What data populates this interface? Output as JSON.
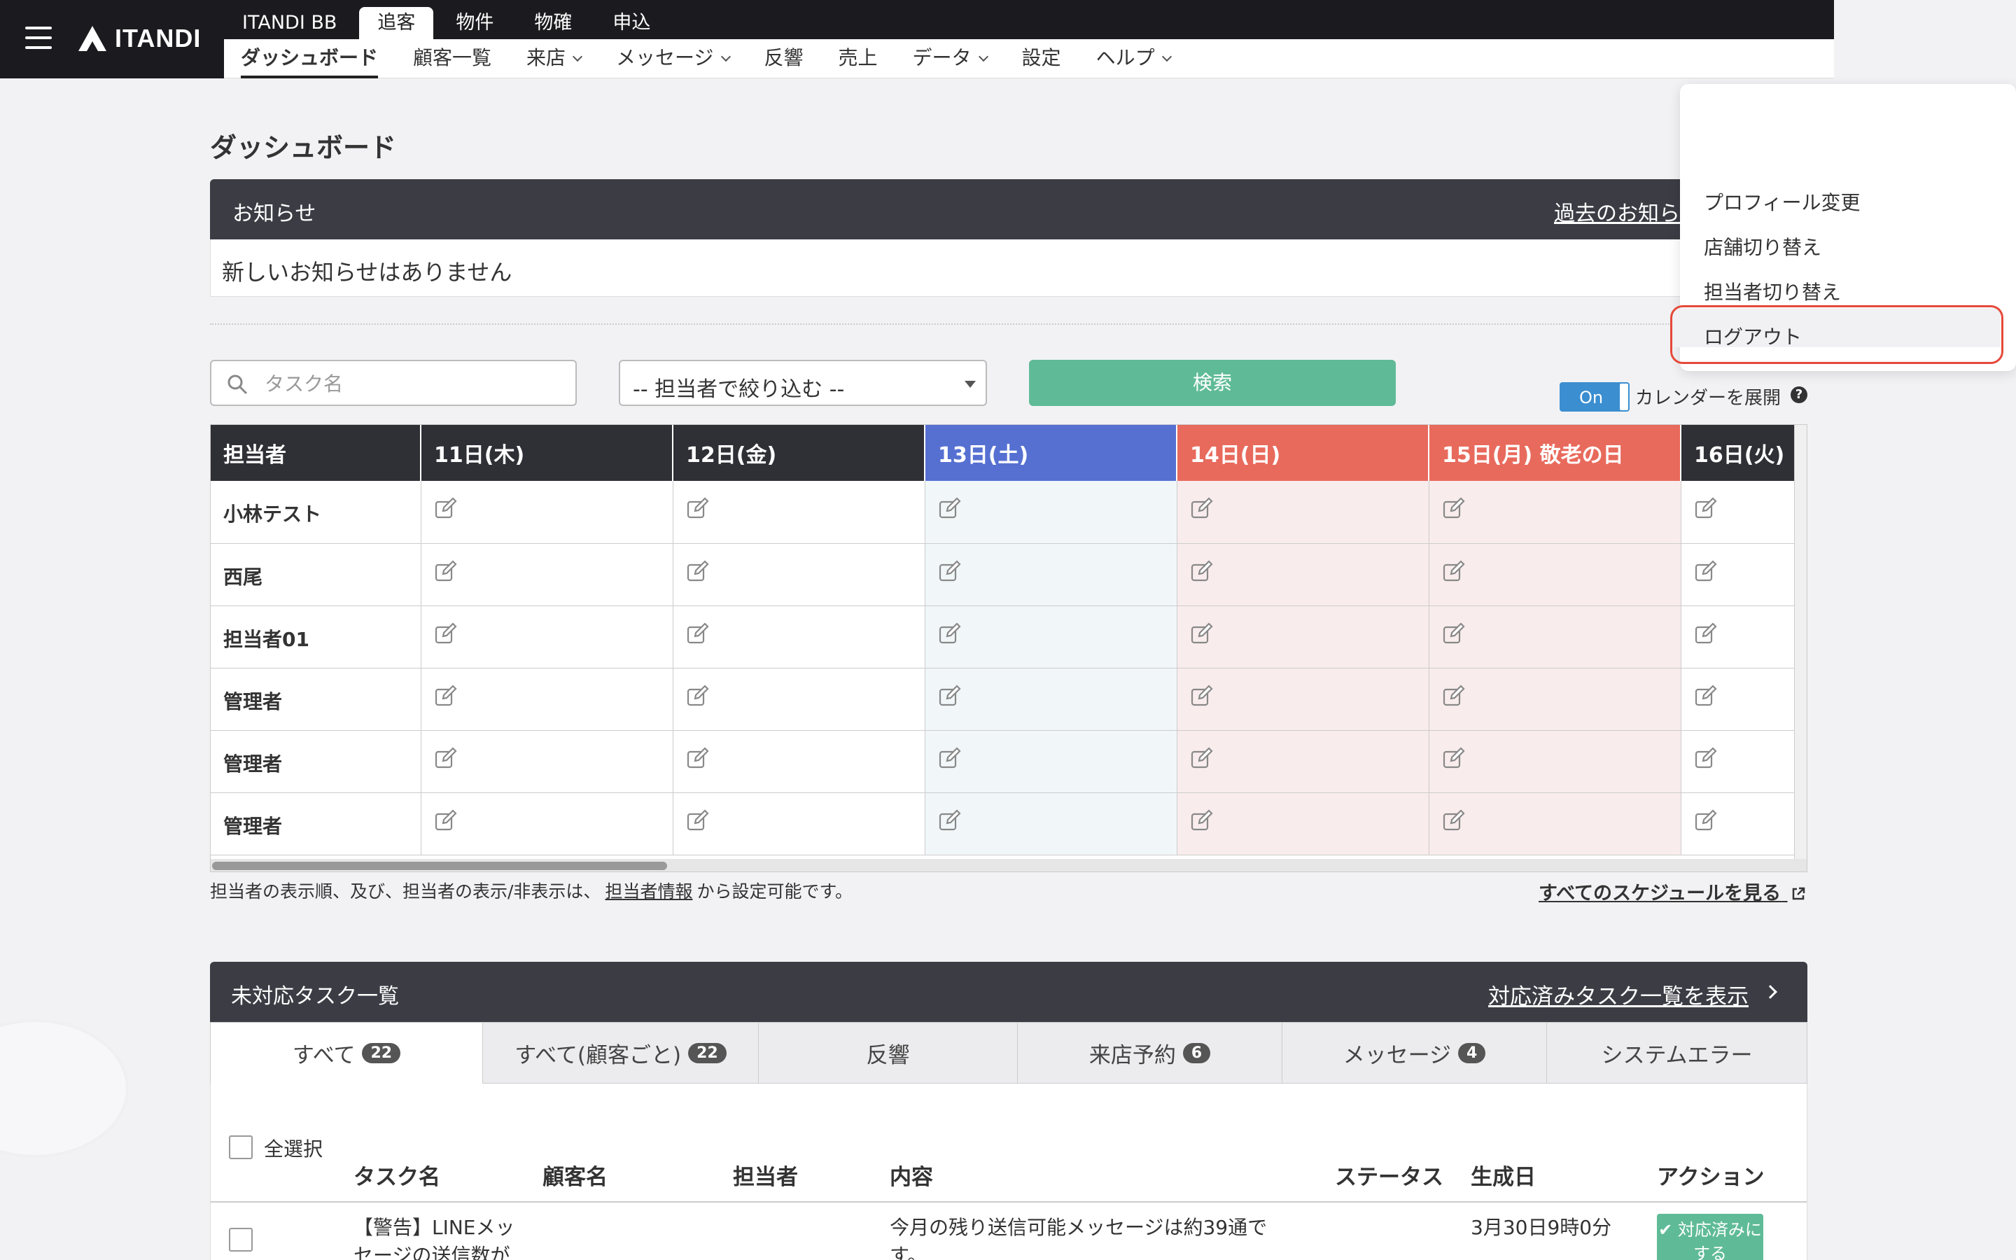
{
  "header": {
    "logo": "ITANDI",
    "top_tabs": [
      "ITANDI BB",
      "追客",
      "物件",
      "物確",
      "申込"
    ],
    "sub_nav": [
      "ダッシュボード",
      "顧客一覧",
      "来店",
      "メッセージ",
      "反響",
      "売上",
      "データ",
      "設定",
      "ヘルプ"
    ]
  },
  "page": {
    "title": "ダッシュボード"
  },
  "notice": {
    "title": "お知らせ",
    "past_link": "過去のお知ら",
    "empty": "新しいお知らせはありません"
  },
  "filters": {
    "task_placeholder": "タスク名",
    "assignee_select": "-- 担当者で絞り込む --",
    "search_button": "検索",
    "toggle_state": "On",
    "toggle_label": "カレンダーを展開"
  },
  "calendar": {
    "header_first": "担当者",
    "days": [
      {
        "label": "11日(木)",
        "type": "weekday"
      },
      {
        "label": "12日(金)",
        "type": "weekday"
      },
      {
        "label": "13日(土)",
        "type": "sat"
      },
      {
        "label": "14日(日)",
        "type": "sun"
      },
      {
        "label": "15日(月) 敬老の日",
        "type": "sun"
      },
      {
        "label": "16日(火)",
        "type": "weekday"
      }
    ],
    "assignees": [
      "小林テスト",
      "西尾",
      "担当者01",
      "管理者",
      "管理者",
      "管理者"
    ],
    "note_prefix": "担当者の表示順、及び、担当者の表示/非表示は、",
    "note_link": "担当者情報",
    "note_suffix": "から設定可能です。",
    "all_schedule_link": "すべてのスケジュールを見る",
    "colors": {
      "sat": "#5670d2",
      "sun": "#e86a5c",
      "dark": "#2f2f36"
    }
  },
  "tasks": {
    "title": "未対応タスク一覧",
    "done_link": "対応済みタスク一覧を表示",
    "tabs": [
      {
        "label": "すべて",
        "count": "22"
      },
      {
        "label": "すべて(顧客ごと)",
        "count": "22"
      },
      {
        "label": "反響",
        "count": ""
      },
      {
        "label": "来店予約",
        "count": "6"
      },
      {
        "label": "メッセージ",
        "count": "4"
      },
      {
        "label": "システムエラー",
        "count": ""
      }
    ],
    "select_all": "全選択",
    "columns": [
      "タスク名",
      "顧客名",
      "担当者",
      "内容",
      "ステータス",
      "生成日",
      "アクション"
    ],
    "rows": [
      {
        "task_name": "【警告】LINEメッセージの送信数が",
        "content": "今月の残り送信可能メッセージは約39通です。",
        "created": "3月30日9時0分",
        "action": "対応済みにする"
      }
    ]
  },
  "user_menu": {
    "items": [
      "プロフィール変更",
      "店舗切り替え",
      "担当者切り替え",
      "ログアウト"
    ]
  }
}
